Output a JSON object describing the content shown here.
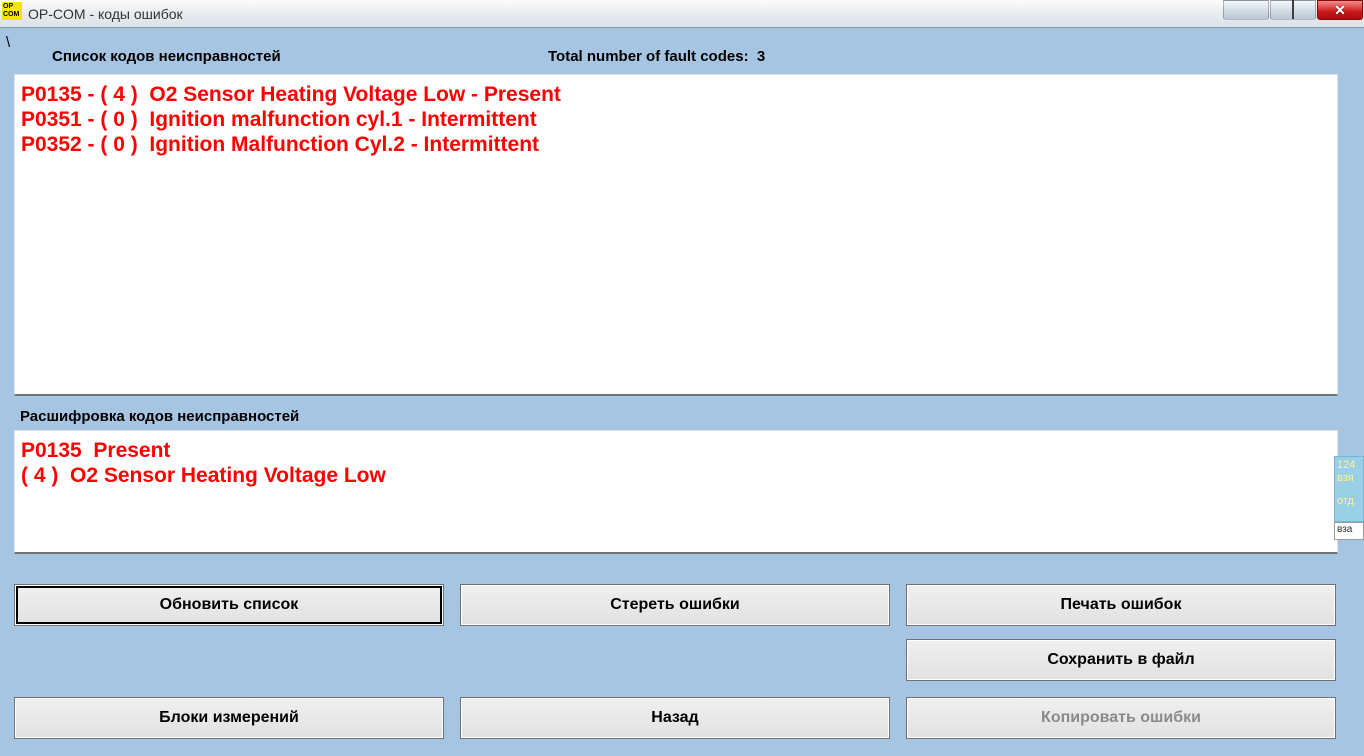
{
  "window": {
    "title": "OP-COM - коды ошибок",
    "icon_text": "OP\nCOM"
  },
  "header": {
    "list_label": "Список кодов неисправностей",
    "total_label": "Total number of fault codes:",
    "total_count": "3",
    "stray_char": "\\"
  },
  "fault_codes": {
    "lines": [
      "P0135 - ( 4 )  O2 Sensor Heating Voltage Low - Present",
      "P0351 - ( 0 )  Ignition malfunction cyl.1 - Intermittent",
      "P0352 - ( 0 )  Ignition Malfunction Cyl.2 - Intermittent"
    ]
  },
  "decode": {
    "label": "Расшифровка кодов неисправностей",
    "lines": [
      "P0135  Present",
      "( 4 )  O2 Sensor Heating Voltage Low"
    ]
  },
  "buttons": {
    "refresh": "Обновить список",
    "erase": "Стереть ошибки",
    "print": "Печать ошибок",
    "save": "Сохранить в файл",
    "blocks": "Блоки измерений",
    "back": "Назад",
    "copy": "Копировать ошибки"
  },
  "side": {
    "line1": "124",
    "line2": "взя",
    "line3": "отд",
    "input": "вза"
  }
}
